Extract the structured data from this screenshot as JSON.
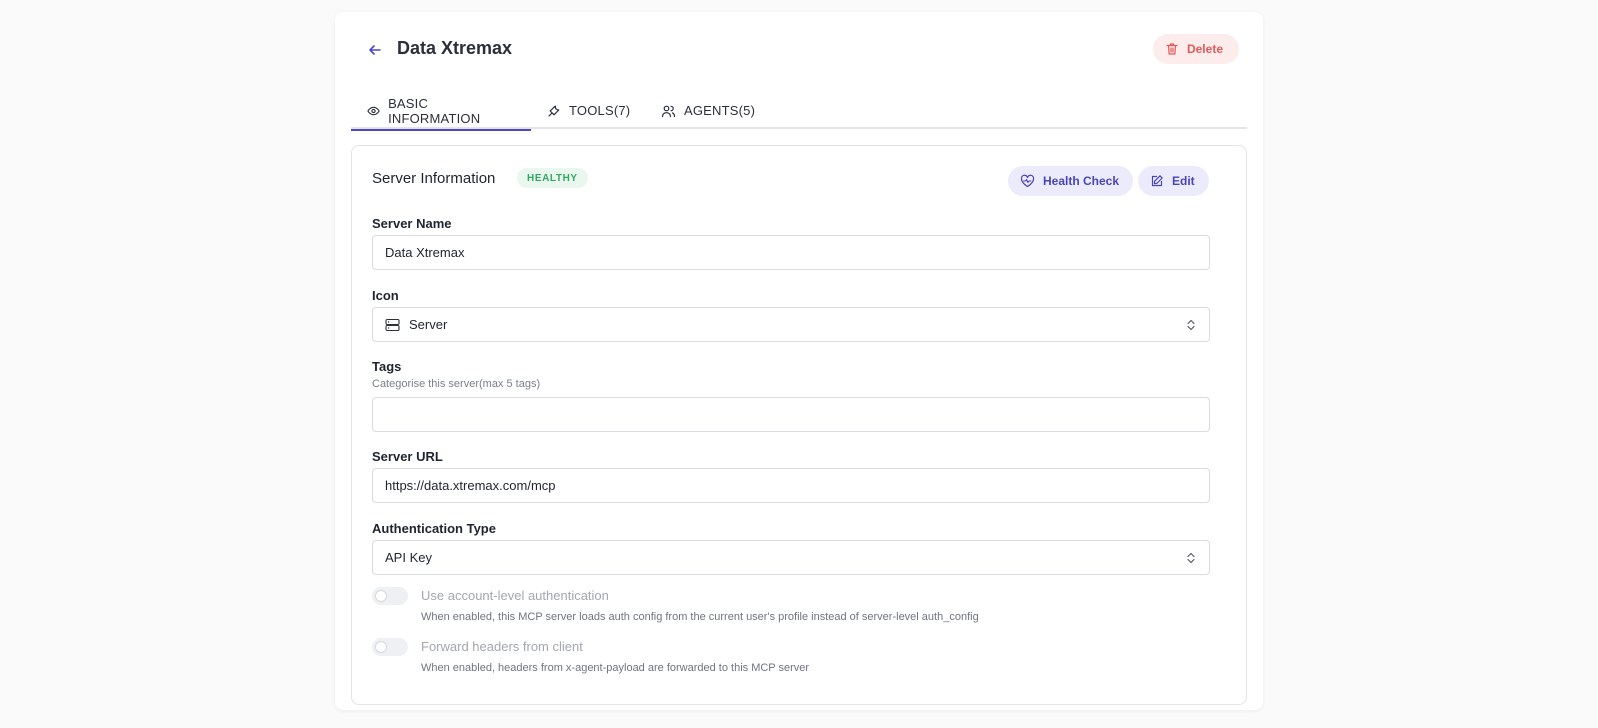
{
  "header": {
    "title": "Data Xtremax",
    "delete_label": "Delete"
  },
  "tabs": [
    {
      "label": "BASIC INFORMATION",
      "icon": "eye-icon",
      "active": true
    },
    {
      "label": "TOOLS(7)",
      "icon": "wrench-icon",
      "active": false
    },
    {
      "label": "AGENTS(5)",
      "icon": "users-icon",
      "active": false
    }
  ],
  "card": {
    "title": "Server Information",
    "status": "HEALTHY",
    "health_check_label": "Health Check",
    "edit_label": "Edit"
  },
  "form": {
    "server_name": {
      "label": "Server Name",
      "value": "Data Xtremax"
    },
    "icon": {
      "label": "Icon",
      "value": "Server",
      "icon": "server-icon"
    },
    "tags": {
      "label": "Tags",
      "help": "Categorise this server(max 5 tags)",
      "value": ""
    },
    "server_url": {
      "label": "Server URL",
      "value": "https://data.xtremax.com/mcp"
    },
    "auth_type": {
      "label": "Authentication Type",
      "value": "API Key"
    }
  },
  "toggles": [
    {
      "label": "Use account-level authentication",
      "help": "When enabled, this MCP server loads auth config from the current user's profile instead of server-level auth_config",
      "on": false
    },
    {
      "label": "Forward headers from client",
      "help": "When enabled, headers from x-agent-payload are forwarded to this MCP server",
      "on": false
    }
  ],
  "colors": {
    "accent": "#4f46c8",
    "danger": "#e05a5a",
    "success": "#34a860"
  }
}
